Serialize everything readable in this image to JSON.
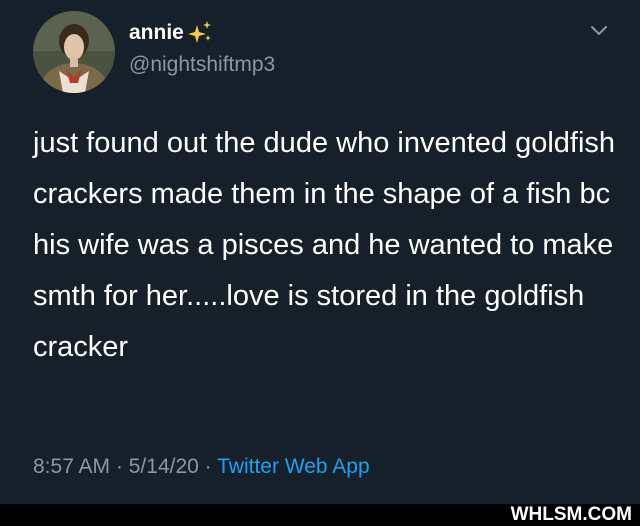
{
  "user": {
    "display_name": "annie",
    "sparkles_icon": "sparkles-icon",
    "handle": "@nightshiftmp3"
  },
  "menu_icon": "chevron-down-icon",
  "tweet": {
    "text": "just found out the dude who invented goldfish crackers made them in the shape of a fish bc his wife was a pisces and he wanted to make smth for her.....love is stored in the goldfish cracker",
    "time": "8:57 AM",
    "date": "5/14/20",
    "separator": "·",
    "source": "Twitter Web App"
  },
  "watermark": "WHLSM.COM",
  "colors": {
    "background": "#15202b",
    "text": "#ffffff",
    "secondary": "#8899a6",
    "link": "#1da1f2"
  }
}
